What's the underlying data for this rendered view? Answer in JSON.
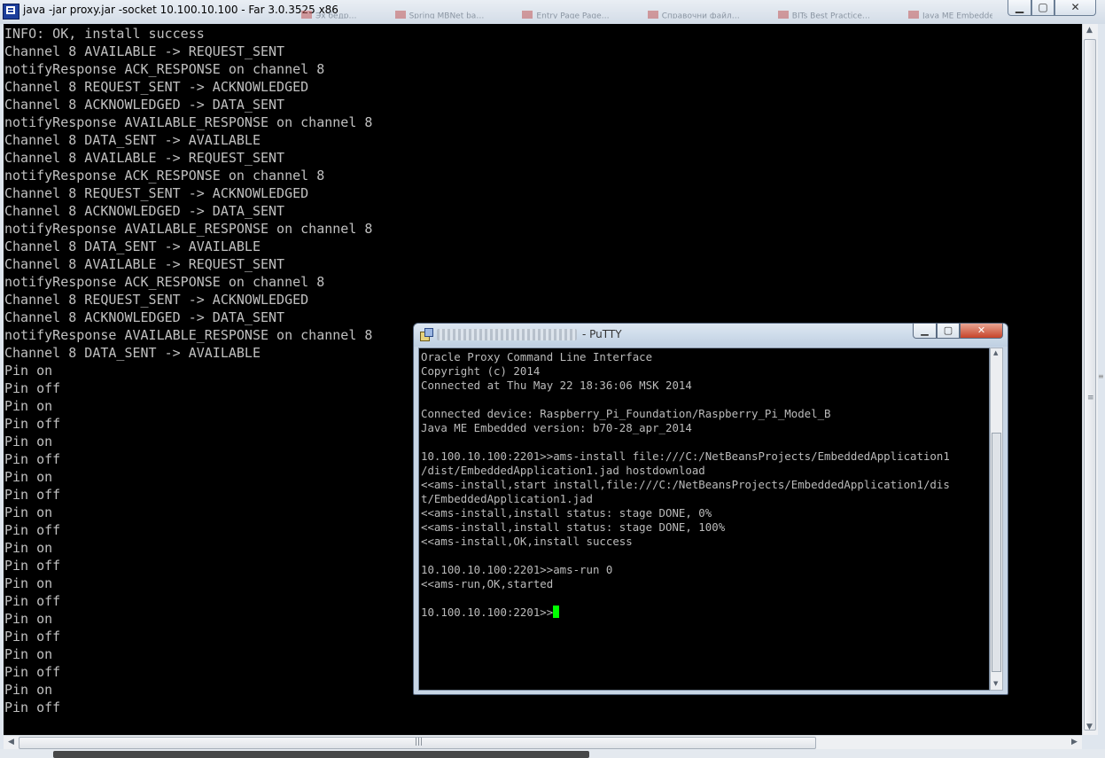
{
  "window": {
    "title": "java -jar proxy.jar -socket 10.100.10.100 - Far 3.0.3525 x86",
    "background_tabs": [
      "Эх бедр…",
      "Spring MBNet ba…",
      "Entry Page  Page…",
      "Справочни файл…",
      "BITs Best Practice…",
      "Java ME Embedde…"
    ],
    "controls": {
      "minimize": "▁",
      "maximize": "▢",
      "close": "✕"
    }
  },
  "console": {
    "lines": [
      "INFO: OK, install success",
      "Channel 8 AVAILABLE -> REQUEST_SENT",
      "notifyResponse ACK_RESPONSE on channel 8",
      "Channel 8 REQUEST_SENT -> ACKNOWLEDGED",
      "Channel 8 ACKNOWLEDGED -> DATA_SENT",
      "notifyResponse AVAILABLE_RESPONSE on channel 8",
      "Channel 8 DATA_SENT -> AVAILABLE",
      "Channel 8 AVAILABLE -> REQUEST_SENT",
      "notifyResponse ACK_RESPONSE on channel 8",
      "Channel 8 REQUEST_SENT -> ACKNOWLEDGED",
      "Channel 8 ACKNOWLEDGED -> DATA_SENT",
      "notifyResponse AVAILABLE_RESPONSE on channel 8",
      "Channel 8 DATA_SENT -> AVAILABLE",
      "Channel 8 AVAILABLE -> REQUEST_SENT",
      "notifyResponse ACK_RESPONSE on channel 8",
      "Channel 8 REQUEST_SENT -> ACKNOWLEDGED",
      "Channel 8 ACKNOWLEDGED -> DATA_SENT",
      "notifyResponse AVAILABLE_RESPONSE on channel 8",
      "Channel 8 DATA_SENT -> AVAILABLE",
      "Pin on",
      "Pin off",
      "Pin on",
      "Pin off",
      "Pin on",
      "Pin off",
      "Pin on",
      "Pin off",
      "Pin on",
      "Pin off",
      "Pin on",
      "Pin off",
      "Pin on",
      "Pin off",
      "Pin on",
      "Pin off",
      "Pin on",
      "Pin off",
      "Pin on",
      "Pin off"
    ]
  },
  "putty": {
    "title": "- PuTTY",
    "controls": {
      "minimize": "▁",
      "maximize": "▢",
      "close": "✕"
    },
    "lines": [
      "Oracle Proxy Command Line Interface",
      "Copyright (c) 2014",
      "Connected at Thu May 22 18:36:06 MSK 2014",
      "",
      "Connected device: Raspberry_Pi_Foundation/Raspberry_Pi_Model_B",
      "Java ME Embedded version: b70-28_apr_2014",
      "",
      "10.100.10.100:2201>>ams-install file:///C:/NetBeansProjects/EmbeddedApplication1",
      "/dist/EmbeddedApplication1.jad hostdownload",
      "<<ams-install,start install,file:///C:/NetBeansProjects/EmbeddedApplication1/dis",
      "t/EmbeddedApplication1.jad",
      "<<ams-install,install status: stage DONE, 0%",
      "<<ams-install,install status: stage DONE, 100%",
      "<<ams-install,OK,install success",
      "",
      "10.100.10.100:2201>>ams-run 0",
      "<<ams-run,OK,started",
      ""
    ],
    "prompt": "10.100.10.100:2201>>",
    "cursor_color": "#00ff00"
  },
  "colors": {
    "console_bg": "#000000",
    "console_fg": "#c0c0c0",
    "putty_fg": "#bbbbbb"
  }
}
